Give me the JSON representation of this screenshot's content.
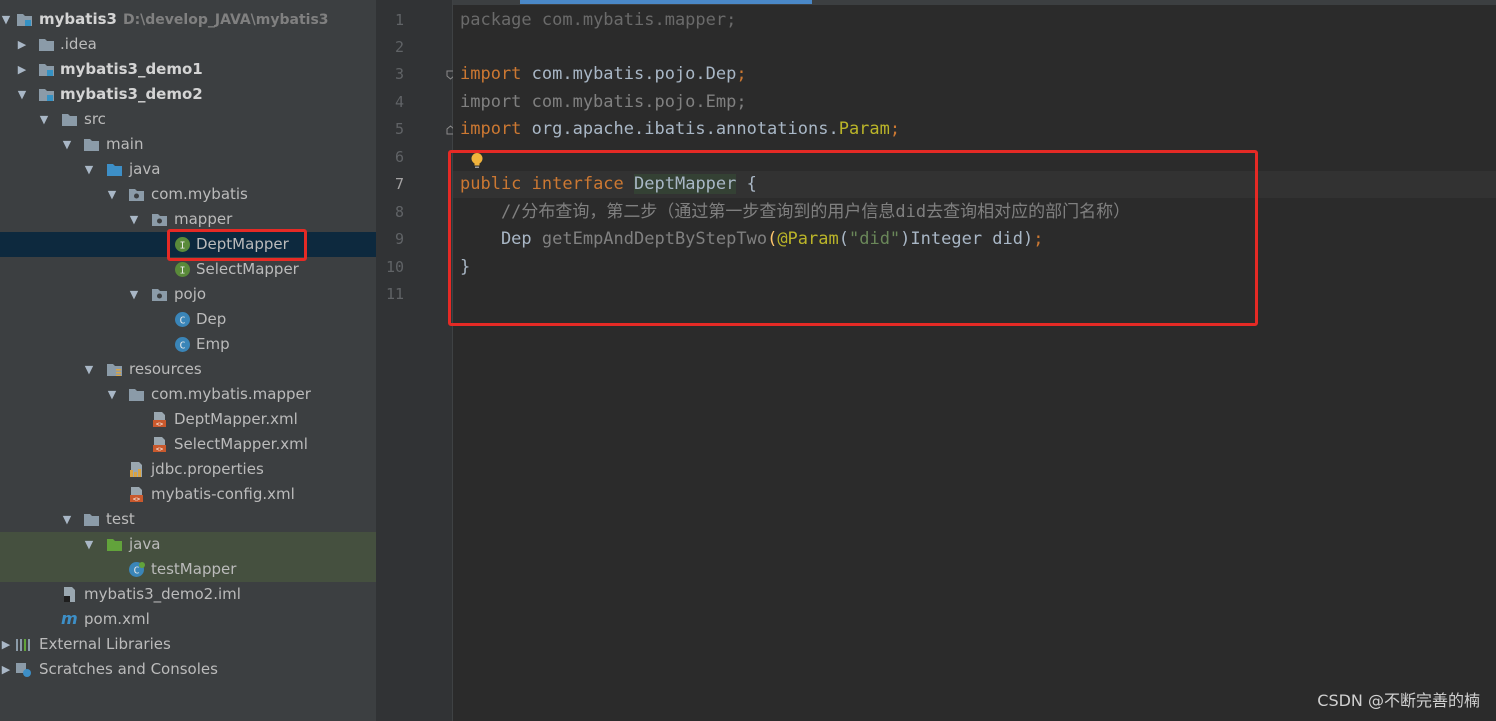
{
  "project_tree": {
    "root": {
      "label": "mybatis3",
      "path": "D:\\develop_JAVA\\mybatis3"
    },
    "items": [
      {
        "label": ".idea"
      },
      {
        "label": "mybatis3_demo1"
      },
      {
        "label": "mybatis3_demo2"
      },
      {
        "label": "src"
      },
      {
        "label": "main"
      },
      {
        "label": "java"
      },
      {
        "label": "com.mybatis"
      },
      {
        "label": "mapper"
      },
      {
        "label": "DeptMapper"
      },
      {
        "label": "SelectMapper"
      },
      {
        "label": "pojo"
      },
      {
        "label": "Dep"
      },
      {
        "label": "Emp"
      },
      {
        "label": "resources"
      },
      {
        "label": "com.mybatis.mapper"
      },
      {
        "label": "DeptMapper.xml"
      },
      {
        "label": "SelectMapper.xml"
      },
      {
        "label": "jdbc.properties"
      },
      {
        "label": "mybatis-config.xml"
      },
      {
        "label": "test"
      },
      {
        "label": "java"
      },
      {
        "label": "testMapper"
      },
      {
        "label": "mybatis3_demo2.iml"
      },
      {
        "label": "pom.xml"
      },
      {
        "label": "External Libraries"
      },
      {
        "label": "Scratches and Consoles"
      }
    ]
  },
  "editor": {
    "line_numbers": [
      "1",
      "2",
      "3",
      "4",
      "5",
      "6",
      "7",
      "8",
      "9",
      "10",
      "11"
    ],
    "lines": {
      "l1_kw": "package",
      "l1_rest": " com.mybatis.mapper",
      "l1_semi": ";",
      "l3_kw": "import",
      "l3_rest": " com.mybatis.pojo.Dep",
      "l3_semi": ";",
      "l4": "import com.mybatis.pojo.Emp;",
      "l5_kw": "import",
      "l5_rest": " org.apache.ibatis.annotations.",
      "l5_param": "Param",
      "l5_semi": ";",
      "l7_kw1": "public",
      "l7_kw2": " interface",
      "l7_name": "DeptMapper",
      "l7_brace": " {",
      "l8": "    //分布查询，第二步（通过第一步查询到的用户信息did去查询相对应的部门名称）",
      "l9_indent": "    Dep ",
      "l9_method": "getEmpAndDeptByStepTwo",
      "l9_paren": "(",
      "l9_ann": "@Param",
      "l9_open": "(",
      "l9_str": "\"did\"",
      "l9_rest": ")Integer did)",
      "l9_semi": ";",
      "l10": "}"
    }
  },
  "watermark": "CSDN @不断完善的楠",
  "colors": {
    "sidebar_bg": "#3c3f41",
    "editor_bg": "#2b2b2b",
    "highlight_red": "#e52a25",
    "keyword": "#cc7832"
  }
}
